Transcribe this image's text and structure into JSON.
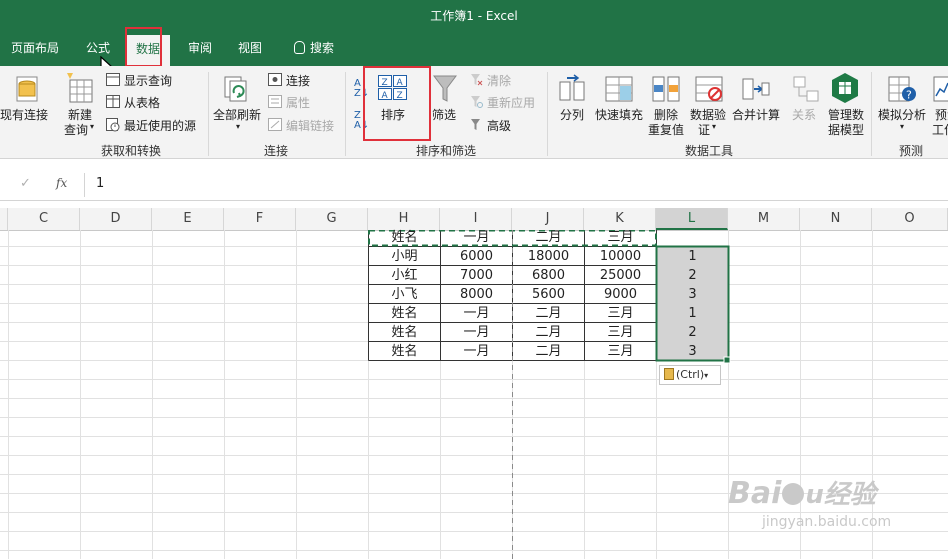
{
  "window": {
    "title": "工作簿1  -  Excel"
  },
  "tabs": [
    {
      "label": "页面布局"
    },
    {
      "label": "公式"
    },
    {
      "label": "数据"
    },
    {
      "label": "审阅"
    },
    {
      "label": "视图"
    },
    {
      "label": "搜索"
    }
  ],
  "ribbon": {
    "existing_connections": "现有连接",
    "new_query": "新建",
    "new_query_2": "查询",
    "show_queries": "显示查询",
    "from_table": "从表格",
    "recent_sources": "最近使用的源",
    "group_get_transform": "获取和转换",
    "refresh_all": "全部刷新",
    "connections": "连接",
    "properties": "属性",
    "edit_links": "编辑链接",
    "group_connections": "连接",
    "sort": "排序",
    "filter": "筛选",
    "clear": "清除",
    "reapply": "重新应用",
    "advanced": "高级",
    "group_sort_filter": "排序和筛选",
    "text_to_columns": "分列",
    "flash_fill": "快速填充",
    "remove_duplicates": "删除",
    "remove_duplicates_2": "重复值",
    "data_validation": "数据验",
    "data_validation_2": "证",
    "consolidate": "合并计算",
    "relationships": "关系",
    "manage_model": "管理数",
    "manage_model_2": "据模型",
    "group_data_tools": "数据工具",
    "what_if": "模拟分析",
    "forecast_sheet": "预测",
    "forecast_sheet_2": "工作",
    "group_forecast": "预测"
  },
  "formula_bar": {
    "cancel": "✓",
    "fx": "fx",
    "value": "1"
  },
  "columns": [
    "C",
    "D",
    "E",
    "F",
    "G",
    "H",
    "I",
    "J",
    "K",
    "L",
    "M",
    "N",
    "O"
  ],
  "table": {
    "header": [
      "姓名",
      "一月",
      "二月",
      "三月"
    ],
    "rows": [
      [
        "小明",
        "6000",
        "18000",
        "10000",
        "1"
      ],
      [
        "小红",
        "7000",
        "6800",
        "25000",
        "2"
      ],
      [
        "小飞",
        "8000",
        "5600",
        "9000",
        "3"
      ],
      [
        "姓名",
        "一月",
        "二月",
        "三月",
        "1"
      ],
      [
        "姓名",
        "一月",
        "二月",
        "三月",
        "2"
      ],
      [
        "姓名",
        "一月",
        "二月",
        "三月",
        "3"
      ]
    ]
  },
  "paste_options": "(Ctrl)",
  "watermark": {
    "brand": "Bai",
    "brand_cn": "经验",
    "url": "jingyan.baidu.com"
  },
  "colors": {
    "excel_green": "#217346",
    "highlight_red": "#e0303a",
    "selection_gray": "#d3d3d3"
  }
}
